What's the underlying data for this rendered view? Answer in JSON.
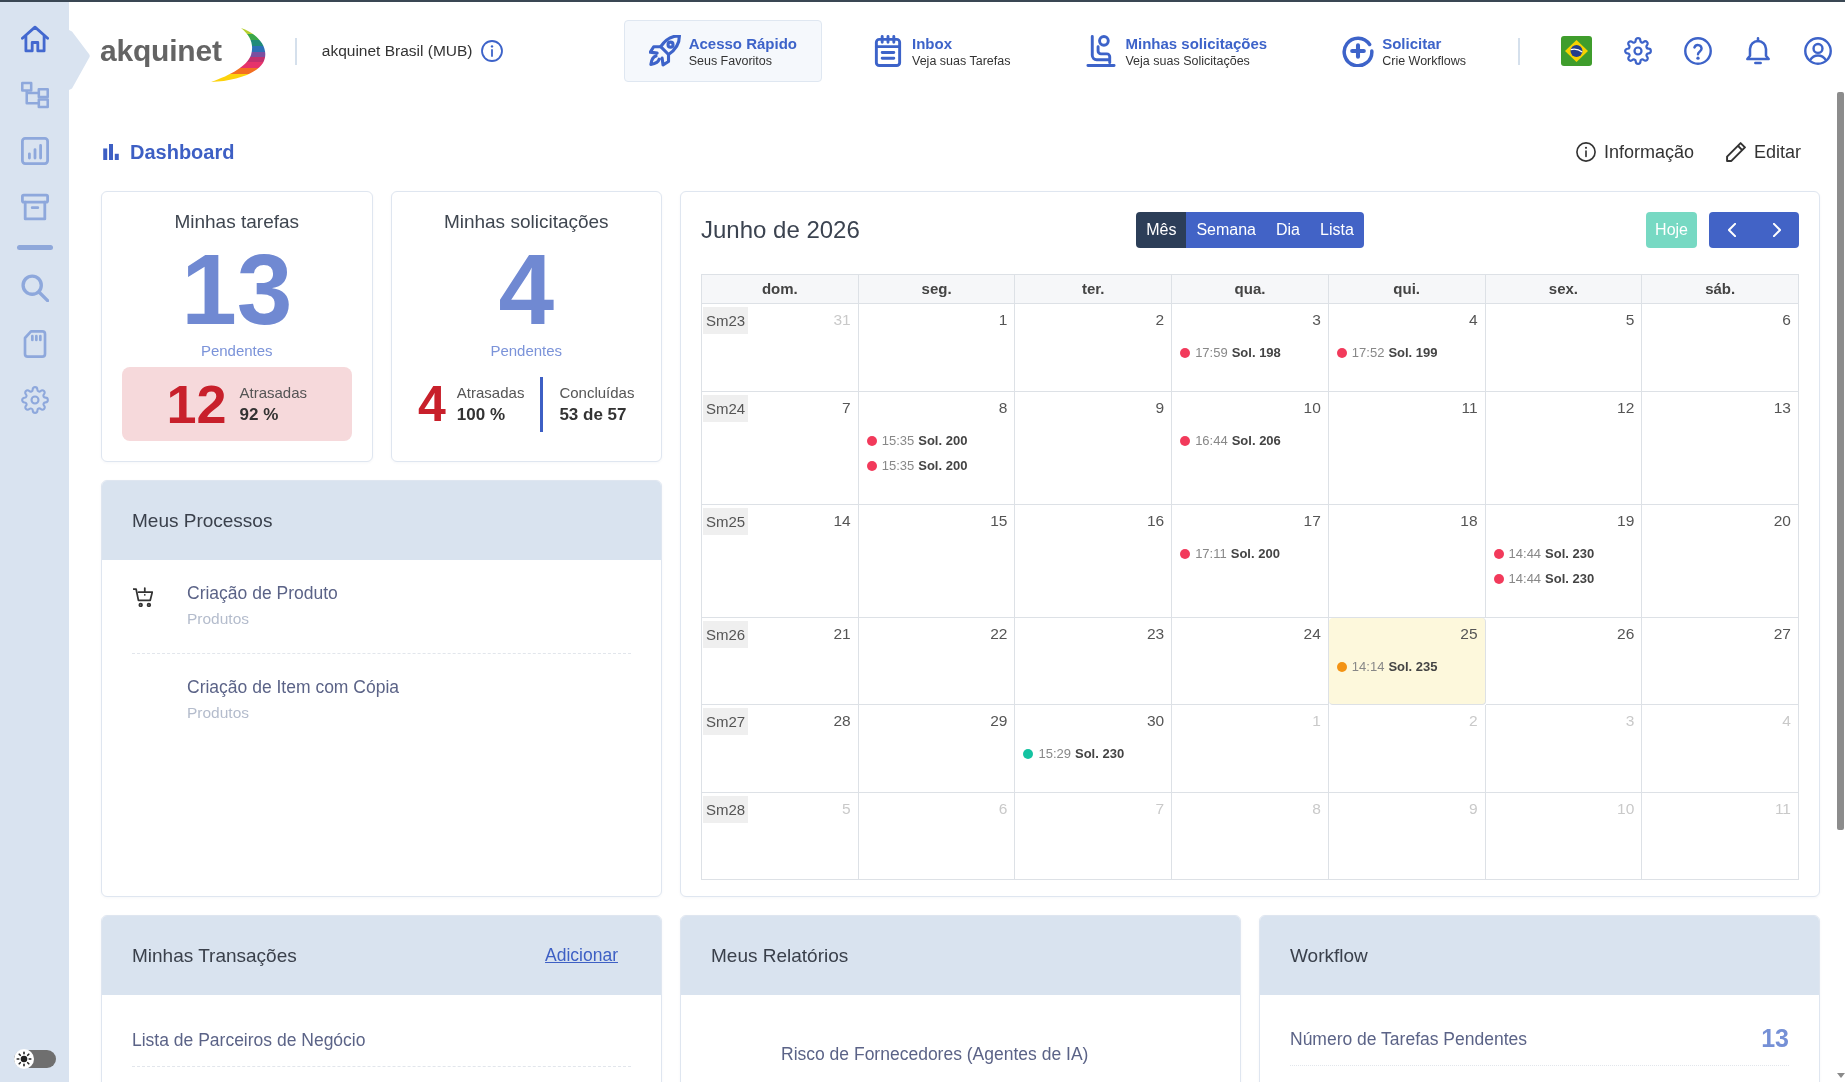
{
  "sidebar": {
    "groups": [
      {
        "items": [
          {
            "selected": true
          },
          {
            "selected": false
          },
          {
            "selected": false
          },
          {
            "selected": false
          }
        ]
      },
      {
        "items": [
          {
            "selected": false
          },
          {
            "selected": false
          },
          {
            "selected": false
          }
        ]
      }
    ],
    "theme_toggle": {
      "on": false
    }
  },
  "header": {
    "brand": "akquinet",
    "organization": "akquinet Brasil (MUB)",
    "quick_links": [
      {
        "title": "Acesso Rápido",
        "subtitle": "Seus Favoritos",
        "selected": true
      },
      {
        "title": "Inbox",
        "subtitle": "Veja suas Tarefas",
        "selected": false
      },
      {
        "title": "Minhas solicitações",
        "subtitle": "Veja suas Solicitações",
        "selected": false
      },
      {
        "title": "Solicitar",
        "subtitle": "Crie Workflows",
        "selected": false
      }
    ]
  },
  "page": {
    "title": "Dashboard",
    "actions": [
      "Informação",
      "Editar"
    ]
  },
  "my_tasks": {
    "title": "Minhas tarefas",
    "count": "13",
    "count_label": "Pendentes",
    "overdue": {
      "count": "12",
      "label": "Atrasadas",
      "percent": "92 %"
    }
  },
  "my_requests": {
    "title": "Minhas solicitações",
    "count": "4",
    "count_label": "Pendentes",
    "overdue": {
      "count": "4",
      "label": "Atrasadas",
      "percent": "100 %"
    },
    "completed": {
      "label": "Concluídas",
      "value": "53 de 57"
    }
  },
  "processes": {
    "title": "Meus Processos",
    "items": [
      {
        "name": "Criação de Produto",
        "category": "Produtos",
        "has_icon": true
      },
      {
        "name": "Criação de Item com Cópia",
        "category": "Produtos",
        "has_icon": false
      }
    ]
  },
  "calendar": {
    "title": "Junho de 2026",
    "views": [
      {
        "label": "Mês",
        "selected": true
      },
      {
        "label": "Semana",
        "selected": false
      },
      {
        "label": "Dia",
        "selected": false
      },
      {
        "label": "Lista",
        "selected": false
      }
    ],
    "today_button": {
      "label": "Hoje",
      "disabled": true
    },
    "weekdays": [
      "dom.",
      "seg.",
      "ter.",
      "qua.",
      "qui.",
      "sex.",
      "sáb."
    ],
    "weeks": [
      {
        "label": "Sm23",
        "days": [
          {
            "day": "31",
            "other_month": true,
            "today": false
          },
          {
            "day": "1",
            "other_month": false,
            "today": false
          },
          {
            "day": "2",
            "other_month": false,
            "today": false
          },
          {
            "day": "3",
            "other_month": false,
            "today": false,
            "events": [
              {
                "time": "17:59",
                "title": "Sol. 198",
                "color": "#f23a5b"
              }
            ]
          },
          {
            "day": "4",
            "other_month": false,
            "today": false,
            "events": [
              {
                "time": "17:52",
                "title": "Sol. 199",
                "color": "#f23a5b"
              }
            ]
          },
          {
            "day": "5",
            "other_month": false,
            "today": false
          },
          {
            "day": "6",
            "other_month": false,
            "today": false
          }
        ]
      },
      {
        "label": "Sm24",
        "days": [
          {
            "day": "7",
            "other_month": false,
            "today": false
          },
          {
            "day": "8",
            "other_month": false,
            "today": false,
            "events": [
              {
                "time": "15:35",
                "title": "Sol. 200",
                "color": "#f23a5b"
              },
              {
                "time": "15:35",
                "title": "Sol. 200",
                "color": "#f23a5b"
              }
            ]
          },
          {
            "day": "9",
            "other_month": false,
            "today": false
          },
          {
            "day": "10",
            "other_month": false,
            "today": false,
            "events": [
              {
                "time": "16:44",
                "title": "Sol. 206",
                "color": "#f23a5b"
              }
            ]
          },
          {
            "day": "11",
            "other_month": false,
            "today": false
          },
          {
            "day": "12",
            "other_month": false,
            "today": false
          },
          {
            "day": "13",
            "other_month": false,
            "today": false
          }
        ]
      },
      {
        "label": "Sm25",
        "days": [
          {
            "day": "14",
            "other_month": false,
            "today": false
          },
          {
            "day": "15",
            "other_month": false,
            "today": false
          },
          {
            "day": "16",
            "other_month": false,
            "today": false
          },
          {
            "day": "17",
            "other_month": false,
            "today": false,
            "events": [
              {
                "time": "17:11",
                "title": "Sol. 200",
                "color": "#f23a5b"
              }
            ]
          },
          {
            "day": "18",
            "other_month": false,
            "today": false
          },
          {
            "day": "19",
            "other_month": false,
            "today": false,
            "events": [
              {
                "time": "14:44",
                "title": "Sol. 230",
                "color": "#f23a5b"
              },
              {
                "time": "14:44",
                "title": "Sol. 230",
                "color": "#f23a5b"
              }
            ]
          },
          {
            "day": "20",
            "other_month": false,
            "today": false
          }
        ]
      },
      {
        "label": "Sm26",
        "days": [
          {
            "day": "21",
            "other_month": false,
            "today": false
          },
          {
            "day": "22",
            "other_month": false,
            "today": false
          },
          {
            "day": "23",
            "other_month": false,
            "today": false
          },
          {
            "day": "24",
            "other_month": false,
            "today": false
          },
          {
            "day": "25",
            "other_month": false,
            "today": true,
            "events": [
              {
                "time": "14:14",
                "title": "Sol. 235",
                "color": "#f39314"
              }
            ]
          },
          {
            "day": "26",
            "other_month": false,
            "today": false
          },
          {
            "day": "27",
            "other_month": false,
            "today": false
          }
        ]
      },
      {
        "label": "Sm27",
        "days": [
          {
            "day": "28",
            "other_month": false,
            "today": false
          },
          {
            "day": "29",
            "other_month": false,
            "today": false
          },
          {
            "day": "30",
            "other_month": false,
            "today": false,
            "events": [
              {
                "time": "15:29",
                "title": "Sol. 230",
                "color": "#14c3a1"
              }
            ]
          },
          {
            "day": "1",
            "other_month": true,
            "today": false
          },
          {
            "day": "2",
            "other_month": true,
            "today": false
          },
          {
            "day": "3",
            "other_month": true,
            "today": false
          },
          {
            "day": "4",
            "other_month": true,
            "today": false
          }
        ]
      },
      {
        "label": "Sm28",
        "days": [
          {
            "day": "5",
            "other_month": true,
            "today": false
          },
          {
            "day": "6",
            "other_month": true,
            "today": false
          },
          {
            "day": "7",
            "other_month": true,
            "today": false
          },
          {
            "day": "8",
            "other_month": true,
            "today": false
          },
          {
            "day": "9",
            "other_month": true,
            "today": false
          },
          {
            "day": "10",
            "other_month": true,
            "today": false
          },
          {
            "day": "11",
            "other_month": true,
            "today": false
          }
        ]
      }
    ]
  },
  "transactions": {
    "title": "Minhas Transações",
    "action": "Adicionar",
    "items": [
      "Lista de Parceiros de Negócio"
    ]
  },
  "reports": {
    "title": "Meus Relatórios",
    "items": [
      "Risco de Fornecedores (Agentes de IA)"
    ]
  },
  "workflow": {
    "title": "Workflow",
    "items": [
      {
        "label": "Número de Tarefas Pendentes",
        "value": "13"
      }
    ]
  }
}
